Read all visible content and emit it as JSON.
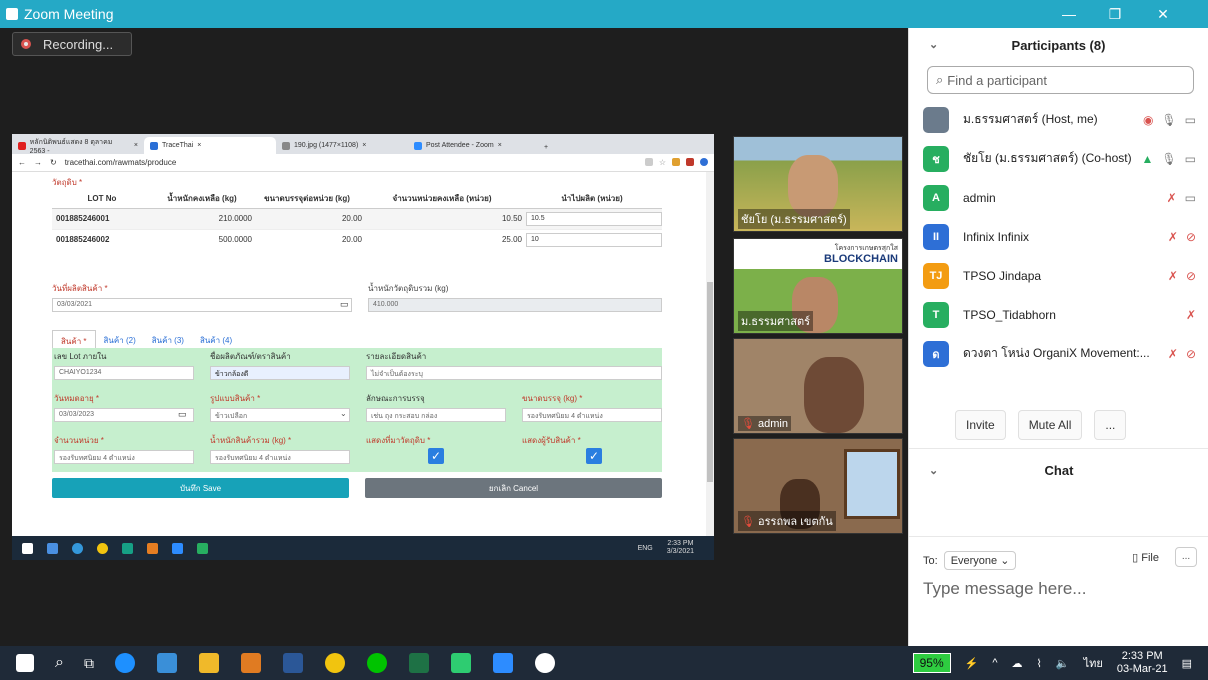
{
  "zoom": {
    "title": "Zoom Meeting",
    "minimize": "—",
    "restore": "❐",
    "close": "✕",
    "recording_label": "Recording..."
  },
  "browser": {
    "tabs": [
      {
        "label": "หลักนิติพนธ์แสดง 8 ตุลาคม 2563 -",
        "close": "×"
      },
      {
        "label": "TraceThai",
        "close": "×"
      },
      {
        "label": "190.jpg (1477×1108)",
        "close": "×"
      },
      {
        "label": "Post Attendee - Zoom",
        "close": "×"
      }
    ],
    "new_tab": "+",
    "url": "tracethai.com/rawmats/produce"
  },
  "form": {
    "raw_label": "วัตถุดิบ *",
    "table": {
      "headers": [
        "LOT No",
        "น้ำหนักคงเหลือ (kg)",
        "ขนาดบรรจุต่อหน่วย (kg)",
        "จำนวนหน่วยคงเหลือ (หน่วย)",
        "นำไปผลิต (หน่วย)"
      ],
      "rows": [
        {
          "lot": "001885246001",
          "weight": "210.0000",
          "size": "20.00",
          "units": "10.50",
          "use": "10.5"
        },
        {
          "lot": "001885246002",
          "weight": "500.0000",
          "size": "20.00",
          "units": "25.00",
          "use": "10"
        }
      ]
    },
    "prod_date_label": "วันที่ผลิตสินค้า *",
    "prod_date_value": "03/03/2021",
    "total_weight_label": "น้ำหนักวัตถุดิบรวม (kg)",
    "total_weight_value": "410.000",
    "product_tabs": [
      "สินค้า *",
      "สินค้า (2)",
      "สินค้า (3)",
      "สินค้า (4)"
    ],
    "lot_label": "เลข Lot ภายใน",
    "lot_value": "CHAIYO1234",
    "name_label": "ชื่อผลิตภัณฑ์/ตราสินค้า",
    "name_value": "ข้าวกล้องดี",
    "detail_label": "รายละเอียดสินค้า",
    "detail_value": "ไม่จำเป็นต้องระบุ",
    "expire_label": "วันหมดอายุ *",
    "expire_value": "03/03/2023",
    "form_label": "รูปแบบสินค้า *",
    "form_value": "ข้าวเปลือก",
    "pack_label": "ลักษณะการบรรจุ",
    "pack_value": "เช่น ถุง กระสอบ กล่อง",
    "pack_size_label": "ขนาดบรรจุ (kg) *",
    "pack_size_value": "รองรับทศนิยม 4 ตำแหน่ง",
    "qty_label": "จำนวนหน่วย *",
    "qty_value": "รองรับทศนิยม 4 ตำแหน่ง",
    "total_prod_label": "น้ำหนักสินค้ารวม (kg) *",
    "total_prod_value": "รองรับทศนิยม 4 ตำแหน่ง",
    "show_source_label": "แสดงที่มาวัตถุดิบ *",
    "show_buyer_label": "แสดงผู้รับสินค้า *",
    "check_mark": "✓",
    "save_label": "บันทึก Save",
    "cancel_label": "ยกเลิก Cancel"
  },
  "inner_taskbar": {
    "lang": "ENG",
    "time": "2:33 PM",
    "date": "3/3/2021"
  },
  "videos": [
    {
      "name": "ชัยโย (ม.ธรรมศาสตร์)"
    },
    {
      "name": "ม.ธรรมศาสตร์",
      "banner_title": "BLOCKCHAIN",
      "banner_sub": "โครงการเกษตรสุกใส"
    },
    {
      "name": "admin"
    },
    {
      "name": "อรรถพล เขตกัน"
    }
  ],
  "participants": {
    "title": "Participants (8)",
    "search_placeholder": "Find a participant",
    "list": [
      {
        "name": "ม.ธรรมศาสตร์ (Host, me)",
        "initials": "",
        "color": "#6b7b8c"
      },
      {
        "name": "ชัยโย (ม.ธรรมศาสตร์) (Co-host)",
        "initials": "ช",
        "color": "#27ae60"
      },
      {
        "name": "admin",
        "initials": "A",
        "color": "#27ae60"
      },
      {
        "name": "Infinix Infinix",
        "initials": "II",
        "color": "#2e6fd6"
      },
      {
        "name": "TPSO Jindapa",
        "initials": "TJ",
        "color": "#f39c12"
      },
      {
        "name": "TPSO_Tidabhorn",
        "initials": "T",
        "color": "#27ae60"
      },
      {
        "name": "ดวงตา โหน่ง OrganiX Movement:...",
        "initials": "ด",
        "color": "#2e6fd6"
      }
    ],
    "invite": "Invite",
    "mute_all": "Mute All",
    "more": "..."
  },
  "chat": {
    "title": "Chat",
    "to_label": "To:",
    "to_value": "Everyone",
    "file_label": "File",
    "more": "...",
    "placeholder": "Type message here..."
  },
  "taskbar": {
    "battery": "95%",
    "lang": "ไทย",
    "time": "2:33 PM",
    "date": "03-Mar-21"
  }
}
